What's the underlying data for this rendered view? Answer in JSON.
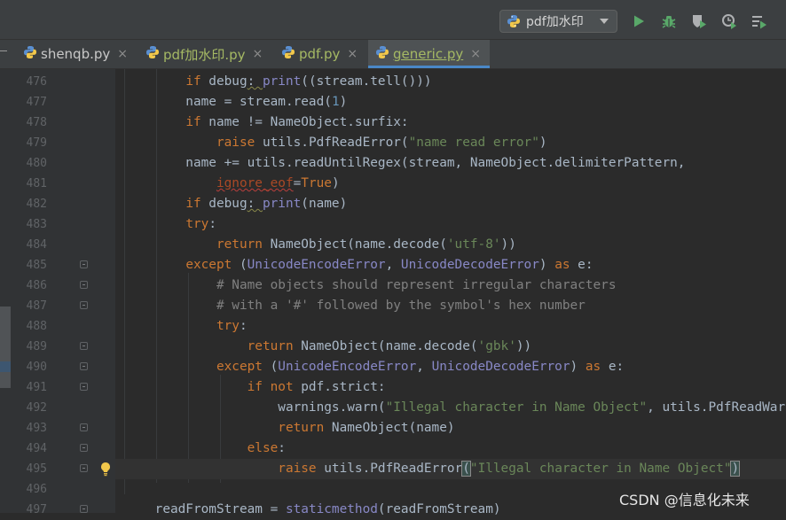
{
  "toolbar": {
    "run_config_label": "pdf加水印",
    "buttons": [
      {
        "name": "run-button",
        "icon": "play-icon"
      },
      {
        "name": "debug-button",
        "icon": "bug-icon"
      },
      {
        "name": "coverage-button",
        "icon": "shield-play-icon"
      },
      {
        "name": "profile-button",
        "icon": "clock-play-icon"
      },
      {
        "name": "run-list-button",
        "icon": "list-play-icon"
      }
    ]
  },
  "tabs": [
    {
      "label": "shenqb.py",
      "active": false,
      "color": "#c8c8c8"
    },
    {
      "label": "pdf加水印.py",
      "active": false,
      "color": "#a5b964"
    },
    {
      "label": "pdf.py",
      "active": false,
      "color": "#a5b964"
    },
    {
      "label": "generic.py",
      "active": true,
      "color": "#a5b964"
    }
  ],
  "tab_close_glyph": "×",
  "editor": {
    "current_line": 495,
    "lines": [
      {
        "n": "476",
        "fold": false,
        "html": "        <span class=\"kw\">if</span> debug<span class=\"sq\">: </span><span class=\"bi\">print</span>((stream.tell()))"
      },
      {
        "n": "477",
        "fold": false,
        "html": "        name = stream.read(<span class=\"nm\">1</span>)"
      },
      {
        "n": "478",
        "fold": false,
        "html": "        <span class=\"kw\">if</span> name != NameObject.surfix:"
      },
      {
        "n": "479",
        "fold": false,
        "html": "            <span class=\"kw\">raise</span> utils.PdfReadError(<span class=\"st\">\"name read error\"</span>)"
      },
      {
        "n": "480",
        "fold": false,
        "html": "        name += utils.readUntilRegex(stream, NameObject.delimiterPattern,"
      },
      {
        "n": "481",
        "fold": false,
        "html": "            <span class=\"pm sqr\">ignore_eof</span>=<span class=\"kw\">True</span>)"
      },
      {
        "n": "482",
        "fold": false,
        "html": "        <span class=\"kw\">if</span> debug<span class=\"sq\">: </span><span class=\"bi\">print</span>(name)"
      },
      {
        "n": "483",
        "fold": false,
        "html": "        <span class=\"kw\">try</span>:"
      },
      {
        "n": "484",
        "fold": false,
        "html": "            <span class=\"kw\">return</span> NameObject(name.decode(<span class=\"st\">'utf-8'</span>))"
      },
      {
        "n": "485",
        "fold": true,
        "html": "        <span class=\"kw\">except</span> (<span class=\"bi\">UnicodeEncodeError</span>, <span class=\"bi\">UnicodeDecodeError</span>) <span class=\"kw\">as</span> e:"
      },
      {
        "n": "486",
        "fold": true,
        "html": "            <span class=\"cm\"># Name objects should represent irregular characters</span>"
      },
      {
        "n": "487",
        "fold": true,
        "html": "            <span class=\"cm\"># with a '#' followed by the symbol's hex number</span>"
      },
      {
        "n": "488",
        "fold": false,
        "html": "            <span class=\"kw\">try</span>:"
      },
      {
        "n": "489",
        "fold": true,
        "html": "                <span class=\"kw\">return</span> NameObject(name.decode(<span class=\"st\">'gbk'</span>))"
      },
      {
        "n": "490",
        "fold": true,
        "html": "            <span class=\"kw\">except</span> (<span class=\"bi\">UnicodeEncodeError</span>, <span class=\"bi\">UnicodeDecodeError</span>) <span class=\"kw\">as</span> e:"
      },
      {
        "n": "491",
        "fold": true,
        "html": "                <span class=\"kw\">if not</span> pdf.strict:"
      },
      {
        "n": "492",
        "fold": false,
        "html": "                    warnings.warn(<span class=\"st\">\"Illegal character in Name Object\"</span>, utils.PdfReadWarni"
      },
      {
        "n": "493",
        "fold": true,
        "html": "                    <span class=\"kw\">return</span> NameObject(name)"
      },
      {
        "n": "494",
        "fold": true,
        "html": "                <span class=\"kw\">else</span>:"
      },
      {
        "n": "495",
        "fold": true,
        "html": "                    <span class=\"kw\">raise</span> utils.PdfReadError<span class=\"brk\">(</span><span class=\"st\">\"Illegal character in Name Object\"</span><span class=\"brk\">)</span>"
      },
      {
        "n": "496",
        "fold": false,
        "html": ""
      },
      {
        "n": "497",
        "fold": true,
        "html": "    readFromStream = <span class=\"bi\">staticmethod</span>(readFromStream)"
      }
    ]
  },
  "watermark": "CSDN @信息化未来"
}
